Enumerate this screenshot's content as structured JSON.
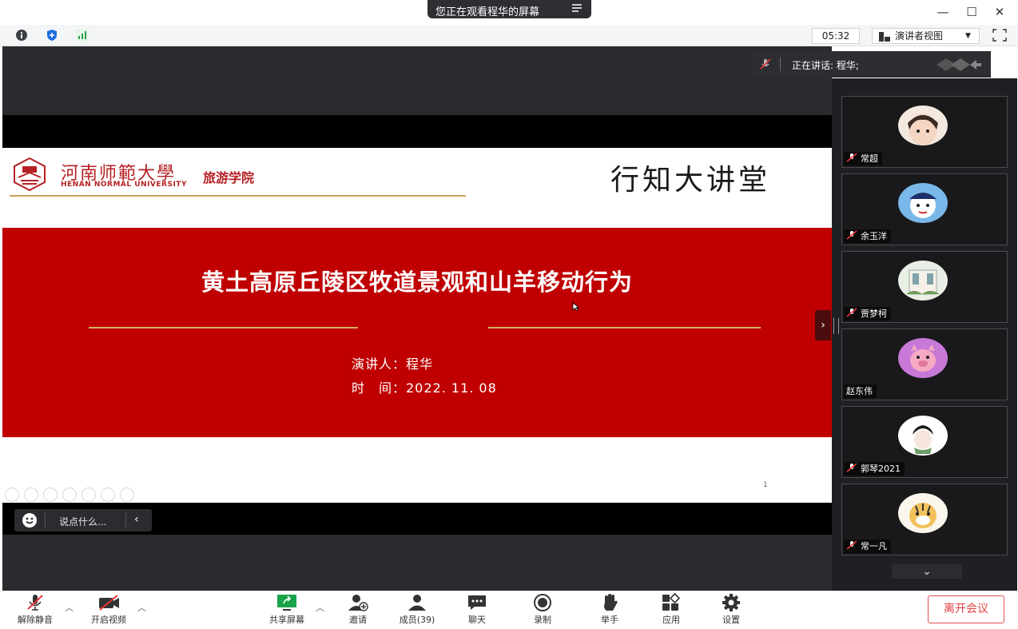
{
  "titlebar": {
    "sharing_notice": "您正在观看程华的屏幕",
    "minimize": "—",
    "maximize": "☐",
    "close": "✕"
  },
  "infobar": {
    "timer": "05:32",
    "view_mode": "演讲者视图"
  },
  "slide": {
    "school_cn": "河南师範大學",
    "school_en": "HENAN NORMAL UNIVERSITY",
    "college": "旅游学院",
    "hall": "行知大讲堂",
    "title": "黄土高原丘陵区牧道景观和山羊移动行为",
    "speaker": "演讲人：程华",
    "date": "时　间：2022. 11. 08",
    "page": "1"
  },
  "chat": {
    "placeholder": "说点什么..."
  },
  "speaking": {
    "text": "正在讲话: 程华;"
  },
  "participants": [
    {
      "name": "常超",
      "muted": true
    },
    {
      "name": "余玉洋",
      "muted": true
    },
    {
      "name": "贾梦柯",
      "muted": true
    },
    {
      "name": "赵东伟",
      "muted": false
    },
    {
      "name": "郭琴2021",
      "muted": true
    },
    {
      "name": "常一凡",
      "muted": true
    }
  ],
  "toolbar": {
    "unmute": "解除静音",
    "start_video": "开启视频",
    "share_screen": "共享屏幕",
    "invite": "邀请",
    "members": "成员(39)",
    "chat": "聊天",
    "record": "录制",
    "raise_hand": "举手",
    "apps": "应用",
    "settings": "设置",
    "leave": "离开会议"
  },
  "colors": {
    "slide_red": "#c00000",
    "brand_red": "#b61f23",
    "gold": "#d4b466",
    "leave_red": "#e34040",
    "share_green": "#1aa34a"
  }
}
